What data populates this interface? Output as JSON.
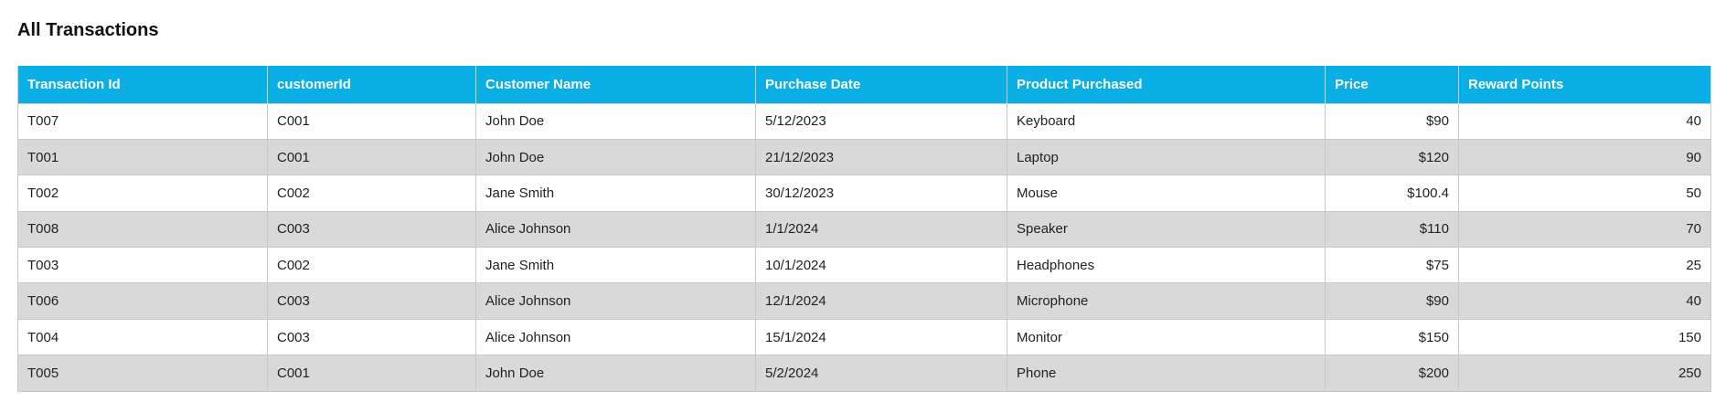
{
  "page": {
    "title": "All Transactions"
  },
  "table": {
    "columns": [
      "Transaction Id",
      "customerId",
      "Customer Name",
      "Purchase Date",
      "Product Purchased",
      "Price",
      "Reward Points"
    ],
    "rows": [
      [
        "T007",
        "C001",
        "John Doe",
        "5/12/2023",
        "Keyboard",
        "$90",
        "40"
      ],
      [
        "T001",
        "C001",
        "John Doe",
        "21/12/2023",
        "Laptop",
        "$120",
        "90"
      ],
      [
        "T002",
        "C002",
        "Jane Smith",
        "30/12/2023",
        "Mouse",
        "$100.4",
        "50"
      ],
      [
        "T008",
        "C003",
        "Alice Johnson",
        "1/1/2024",
        "Speaker",
        "$110",
        "70"
      ],
      [
        "T003",
        "C002",
        "Jane Smith",
        "10/1/2024",
        "Headphones",
        "$75",
        "25"
      ],
      [
        "T006",
        "C003",
        "Alice Johnson",
        "12/1/2024",
        "Microphone",
        "$90",
        "40"
      ],
      [
        "T004",
        "C003",
        "Alice Johnson",
        "15/1/2024",
        "Monitor",
        "$150",
        "150"
      ],
      [
        "T005",
        "C001",
        "John Doe",
        "5/2/2024",
        "Phone",
        "$200",
        "250"
      ]
    ],
    "header_color": "#0aafe6",
    "stripe_color": "#d9d9d9"
  }
}
